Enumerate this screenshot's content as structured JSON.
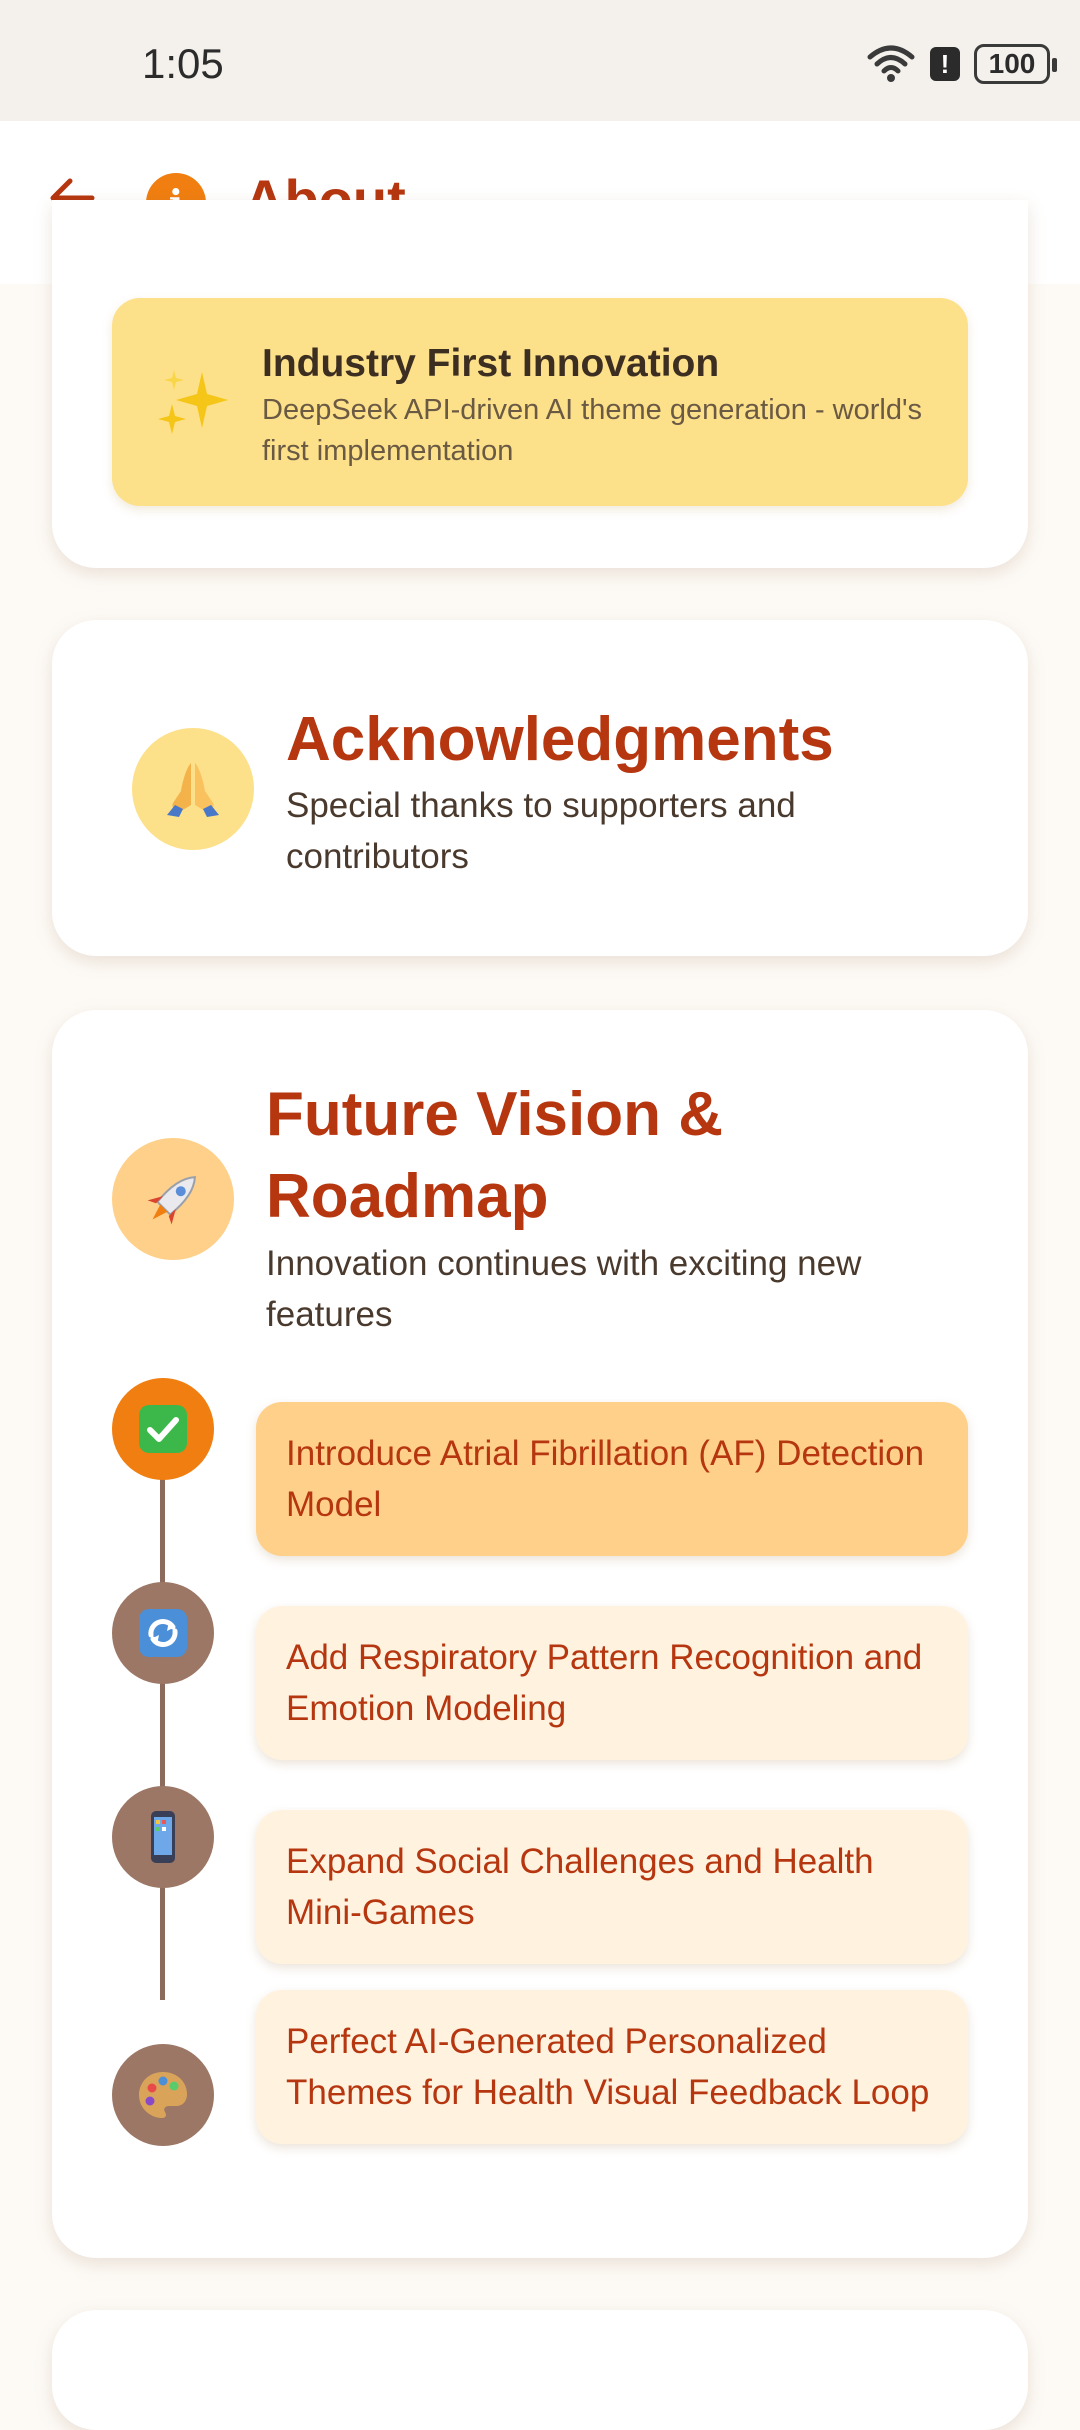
{
  "status_bar": {
    "time": "1:05",
    "battery": "100",
    "icons": [
      "wifi-icon",
      "alert-icon",
      "battery-icon"
    ]
  },
  "app_bar": {
    "title": "About",
    "back_icon": "arrow-left-icon",
    "info_glyph": "i"
  },
  "innovation": {
    "title": "Industry First Innovation",
    "description": "DeepSeek API-driven AI theme generation - world's first implementation",
    "icon": "sparkles-icon"
  },
  "acknowledgments": {
    "title": "Acknowledgments",
    "description": "Special thanks to supporters and contributors",
    "icon": "praying-hands-icon"
  },
  "roadmap": {
    "title": "Future Vision & Roadmap",
    "description": "Innovation continues with exciting new features",
    "icon": "rocket-icon",
    "items": [
      {
        "label": "Introduce Atrial Fibrillation (AF) Detection Model",
        "icon": "check-mark-icon",
        "status": "active"
      },
      {
        "label": "Add Respiratory Pattern Recognition and Emotion Modeling",
        "icon": "refresh-icon",
        "status": "pending"
      },
      {
        "label": "Expand Social Challenges and Health Mini-Games",
        "icon": "mobile-phone-icon",
        "status": "pending"
      },
      {
        "label": "Perfect AI-Generated Personalized Themes for Health Visual Feedback Loop",
        "icon": "palette-icon",
        "status": "pending"
      }
    ]
  },
  "colors": {
    "accent": "#B5360F",
    "orange": "#F07E10",
    "highlight": "#FDE08A",
    "timeline_inactive": "#9C7766"
  }
}
